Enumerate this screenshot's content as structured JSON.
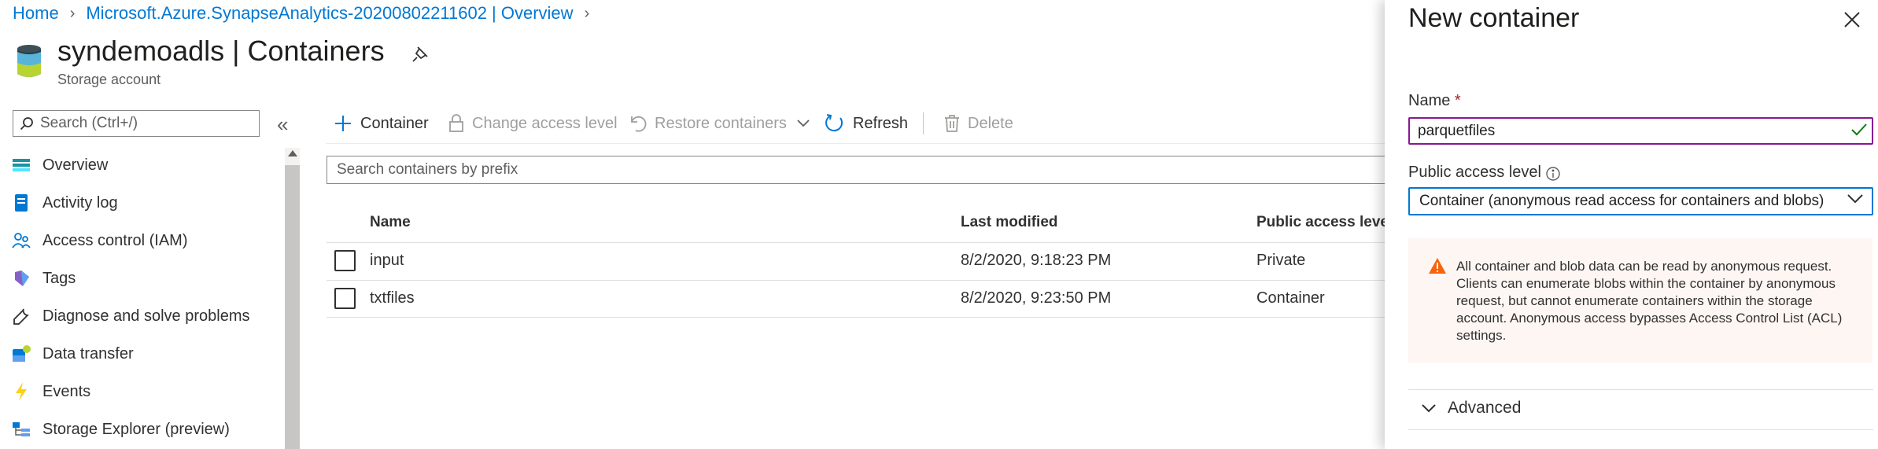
{
  "breadcrumb": {
    "home": "Home",
    "resource": "Microsoft.Azure.SynapseAnalytics-20200802211602 | Overview"
  },
  "header": {
    "title": "syndemoadls | Containers",
    "subtitle": "Storage account"
  },
  "sidebar": {
    "search_placeholder": "Search (Ctrl+/)",
    "collapse_glyph": "«",
    "items": [
      {
        "label": "Overview",
        "icon": "overview-icon"
      },
      {
        "label": "Activity log",
        "icon": "activity-log-icon"
      },
      {
        "label": "Access control (IAM)",
        "icon": "iam-icon"
      },
      {
        "label": "Tags",
        "icon": "tag-icon"
      },
      {
        "label": "Diagnose and solve problems",
        "icon": "wrench-icon"
      },
      {
        "label": "Data transfer",
        "icon": "data-transfer-icon"
      },
      {
        "label": "Events",
        "icon": "lightning-icon"
      },
      {
        "label": "Storage Explorer (preview)",
        "icon": "storage-explorer-icon"
      }
    ]
  },
  "toolbar": {
    "container": "Container",
    "change_access": "Change access level",
    "restore": "Restore containers",
    "refresh": "Refresh",
    "delete": "Delete"
  },
  "containers": {
    "search_placeholder": "Search containers by prefix",
    "columns": [
      "Name",
      "Last modified",
      "Public access level"
    ],
    "rows": [
      {
        "name": "input",
        "modified": "8/2/2020, 9:18:23 PM",
        "access": "Private"
      },
      {
        "name": "txtfiles",
        "modified": "8/2/2020, 9:23:50 PM",
        "access": "Container"
      }
    ]
  },
  "panel": {
    "title": "New container",
    "name_label": "Name",
    "required_mark": "*",
    "name_value": "parquetfiles",
    "access_label": "Public access level",
    "access_value": "Container (anonymous read access for containers and blobs)",
    "warning": "All container and blob data can be read by anonymous request. Clients can enumerate blobs within the container by anonymous request, but cannot enumerate containers within the storage account. Anonymous access bypasses Access Control List (ACL) settings.",
    "advanced": "Advanced"
  },
  "colors": {
    "accent": "#0078d4",
    "focus_purple": "#881798",
    "success": "#107c10",
    "warning": "#f7630c"
  }
}
